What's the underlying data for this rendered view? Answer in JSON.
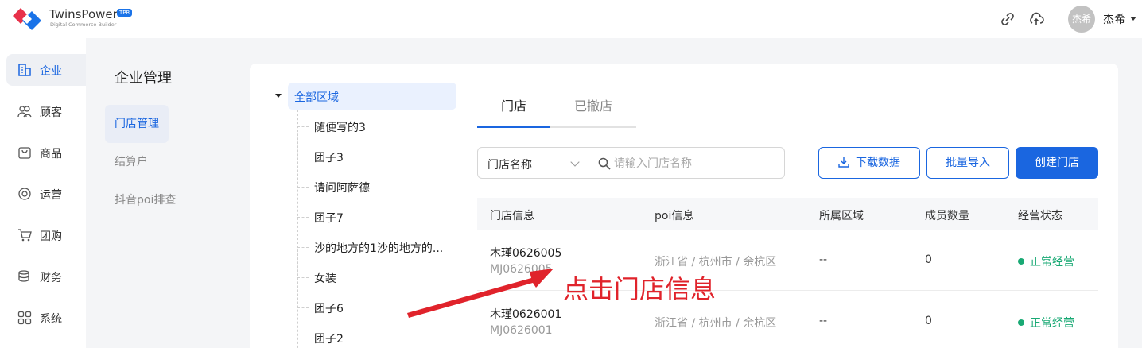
{
  "brand": {
    "name": "TwinsPower",
    "badge": "TPR",
    "subtitle": "Digital Commerce Builder"
  },
  "topbar": {
    "icons": [
      "link-icon",
      "cloud-upload-icon"
    ],
    "avatar_text": "杰希",
    "username": "杰希"
  },
  "leftnav": {
    "items": [
      {
        "label": "企业",
        "icon": "building-icon",
        "active": true
      },
      {
        "label": "顾客",
        "icon": "users-icon"
      },
      {
        "label": "商品",
        "icon": "bag-icon"
      },
      {
        "label": "运营",
        "icon": "target-icon"
      },
      {
        "label": "团购",
        "icon": "cart-icon"
      },
      {
        "label": "财务",
        "icon": "coins-icon"
      },
      {
        "label": "系统",
        "icon": "grid-icon"
      }
    ]
  },
  "subnav": {
    "title": "企业管理",
    "items": [
      {
        "label": "门店管理",
        "active": true
      },
      {
        "label": "结算户"
      },
      {
        "label": "抖音poi排查"
      }
    ]
  },
  "tree": {
    "root": "全部区域",
    "nodes": [
      "随便写的3",
      "团子3",
      "请问阿萨德",
      "团子7",
      "沙的地方的1沙的地方的...",
      "女装",
      "团子6",
      "团子2"
    ]
  },
  "tabs": [
    {
      "label": "门店",
      "active": true
    },
    {
      "label": "已撤店"
    }
  ],
  "filter": {
    "select_value": "门店名称",
    "search_placeholder": "请输入门店名称",
    "download_label": "下载数据",
    "import_label": "批量导入",
    "create_label": "创建门店"
  },
  "table": {
    "columns": [
      "门店信息",
      "poi信息",
      "所属区域",
      "成员数量",
      "经营状态"
    ],
    "rows": [
      {
        "name": "木瑾0626005",
        "code": "MJ0626005",
        "poi": "浙江省 / 杭州市 / 余杭区",
        "region": "--",
        "members": "0",
        "status": "正常经营"
      },
      {
        "name": "木瑾0626001",
        "code": "MJ0626001",
        "poi": "浙江省 / 杭州市 / 余杭区",
        "region": "--",
        "members": "0",
        "status": "正常经营"
      }
    ]
  },
  "annotation": {
    "text": "点击门店信息"
  },
  "colors": {
    "accent": "#1a66e0",
    "status": "#19a974",
    "annotation": "#e0232b"
  }
}
